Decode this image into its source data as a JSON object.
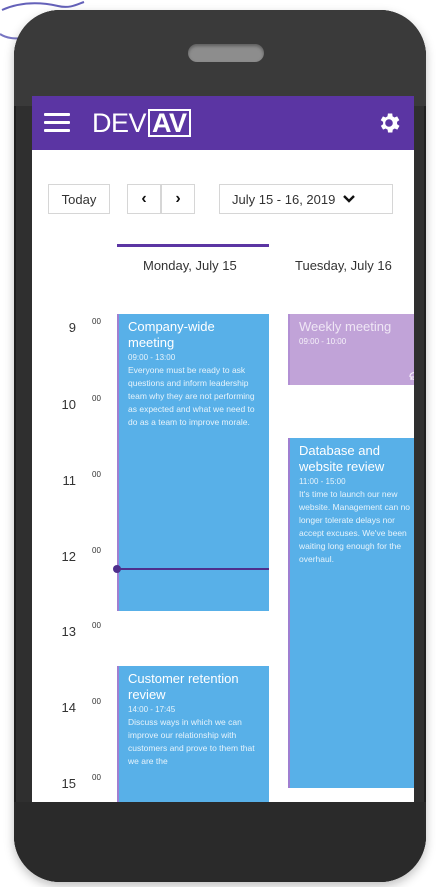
{
  "app": {
    "logo_text": "DEV",
    "logo_boxed": "AV"
  },
  "toolbar": {
    "today_label": "Today",
    "prev_symbol": "‹",
    "next_symbol": "›",
    "range_label": "July 15 - 16, 2019",
    "range_chevron": "⌄"
  },
  "days": [
    {
      "label": "Monday, July 15"
    },
    {
      "label": "Tuesday, July 16"
    }
  ],
  "hours": [
    {
      "hour": "9",
      "min": "00"
    },
    {
      "hour": "10",
      "min": "00"
    },
    {
      "hour": "11",
      "min": "00"
    },
    {
      "hour": "12",
      "min": "00"
    },
    {
      "hour": "13",
      "min": "00"
    },
    {
      "hour": "14",
      "min": "00"
    },
    {
      "hour": "15",
      "min": "00"
    }
  ],
  "events": [
    {
      "title": "Company-wide meeting",
      "time": "09:00 - 13:00",
      "desc": "Everyone must be ready to ask questions and inform leadership team why they are not performing as expected and what we need to do as a team to improve morale."
    },
    {
      "title": "Weekly meeting",
      "time": "09:00 - 10:00"
    },
    {
      "title": "Database and website review",
      "time": "11:00 - 15:00",
      "desc": "It's time to launch our new website. Management can no longer tolerate delays nor accept excuses. We've been waiting long enough for the overhaul."
    },
    {
      "title": "Customer retention review",
      "time": "14:00 - 17:45",
      "desc": "Discuss ways in which we can improve our relationship with customers and prove to them that we are the"
    }
  ],
  "colors": {
    "brand": "#5b35a3",
    "event": "#58b0e8",
    "event_past": "#c1a3d8"
  },
  "icons": {
    "menu": "hamburger-icon",
    "settings": "gear-icon",
    "repeat": "repeat-icon"
  }
}
